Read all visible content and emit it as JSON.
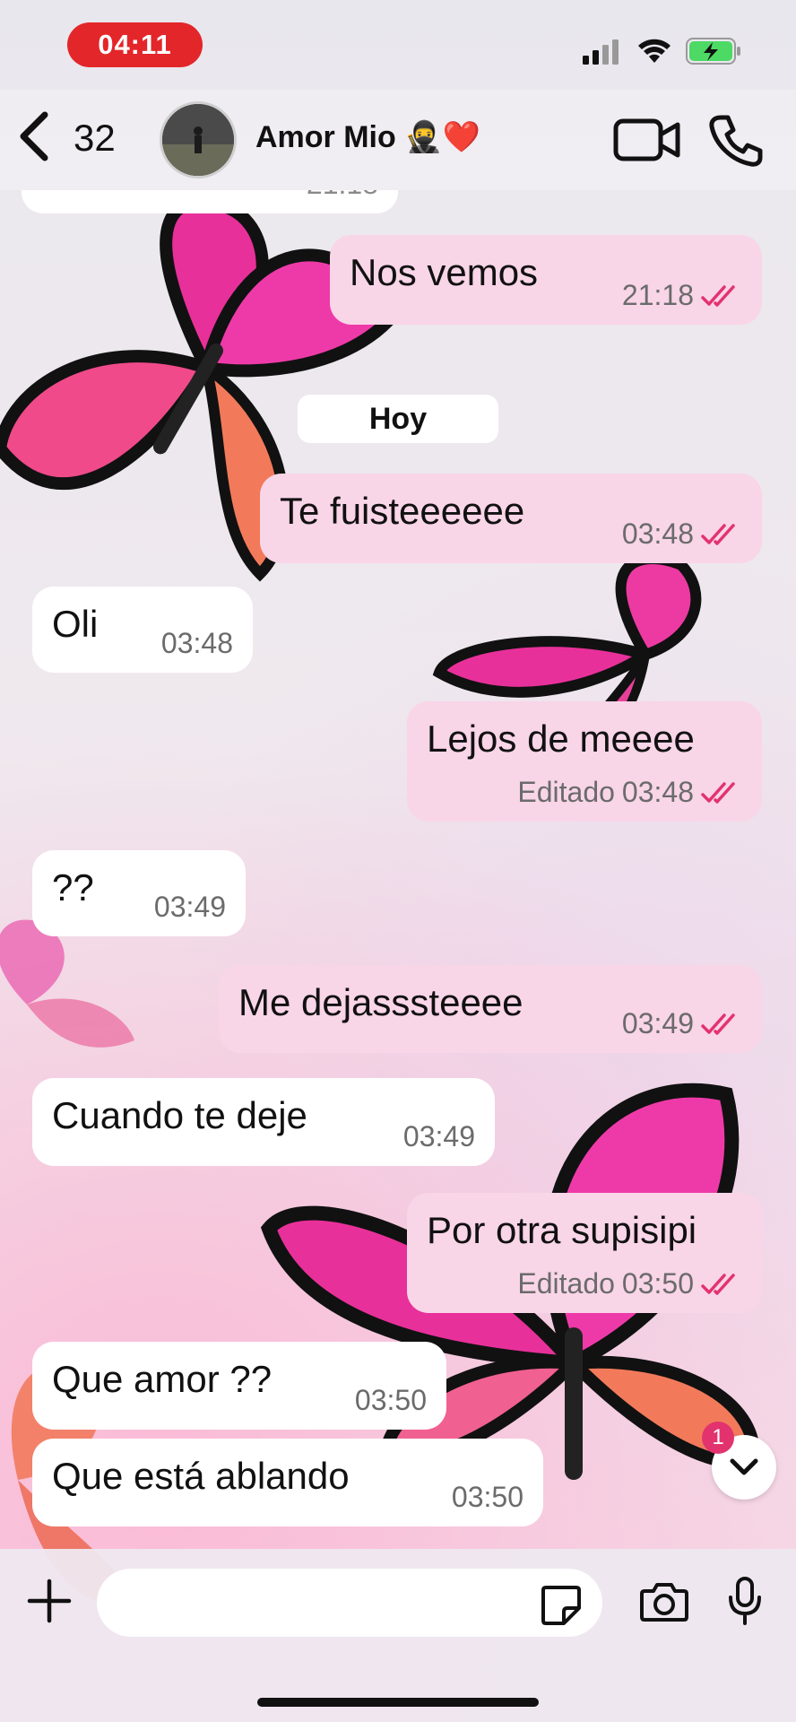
{
  "status_bar": {
    "time": "04:11"
  },
  "header": {
    "back_count": "32",
    "contact_name": "Amor  Mio 🥷❤️"
  },
  "date_separator": "Hoy",
  "partial_top_meta": "21:18",
  "messages": [
    {
      "dir": "out",
      "text": "Nos vemos",
      "time": "21:18",
      "edited": ""
    },
    {
      "dir": "out",
      "text": "Te fuisteeeeee",
      "time": "03:48",
      "edited": ""
    },
    {
      "dir": "in",
      "text": "Oli",
      "time": "03:48",
      "edited": ""
    },
    {
      "dir": "out",
      "text": "Lejos de meeee",
      "time": "03:48",
      "edited": "Editado"
    },
    {
      "dir": "in",
      "text": "??",
      "time": "03:49",
      "edited": ""
    },
    {
      "dir": "out",
      "text": "Me dejasssteeee",
      "time": "03:49",
      "edited": ""
    },
    {
      "dir": "in",
      "text": "Cuando te deje",
      "time": "03:49",
      "edited": ""
    },
    {
      "dir": "out",
      "text": "Por otra supisipi",
      "time": "03:50",
      "edited": "Editado"
    },
    {
      "dir": "in",
      "text": "Que amor ??",
      "time": "03:50",
      "edited": ""
    },
    {
      "dir": "in",
      "text": "Que está ablando",
      "time": "03:50",
      "edited": ""
    }
  ],
  "scroll_badge": "1",
  "colors": {
    "outgoing": "#f9d5e8",
    "incoming": "#ffffff",
    "tick": "#e2336f",
    "time_pill": "#e3262a"
  },
  "icons": [
    "back-chevron-icon",
    "video-icon",
    "phone-icon",
    "plus-icon",
    "sticker-icon",
    "camera-icon",
    "mic-icon",
    "chevron-down-icon",
    "read-ticks-icon"
  ]
}
